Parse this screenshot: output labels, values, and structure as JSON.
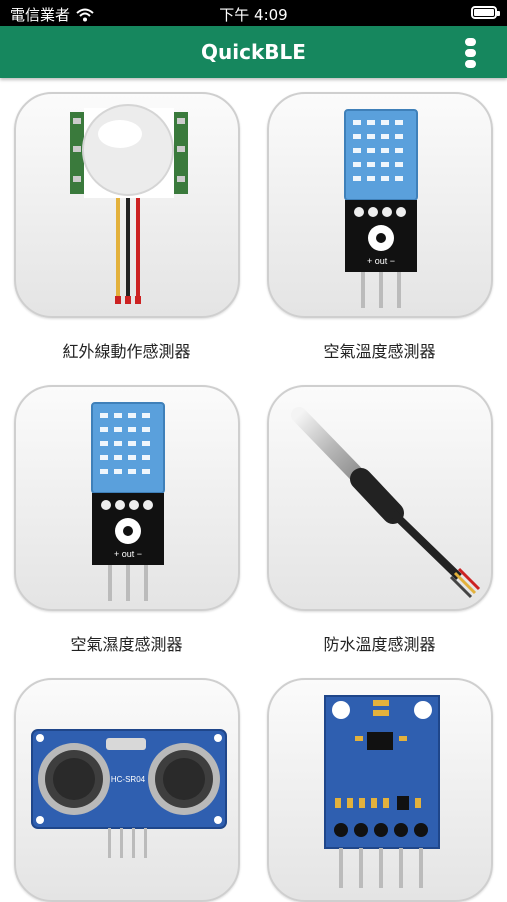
{
  "status": {
    "carrier": "電信業者",
    "time": "下午 4:09"
  },
  "appbar": {
    "title": "QuickBLE",
    "menu_icon": "more-vertical-icon"
  },
  "accent": "#16875e",
  "sensors": [
    {
      "label": "紅外線動作感測器",
      "icon": "pir-motion-sensor-icon"
    },
    {
      "label": "空氣溫度感測器",
      "icon": "dht-temperature-sensor-icon"
    },
    {
      "label": "空氣濕度感測器",
      "icon": "dht-humidity-sensor-icon"
    },
    {
      "label": "防水溫度感測器",
      "icon": "waterproof-probe-icon"
    },
    {
      "label": "",
      "icon": "ultrasonic-sensor-icon",
      "chip_text": "HC-SR04"
    },
    {
      "label": "",
      "icon": "gyro-module-icon"
    }
  ]
}
